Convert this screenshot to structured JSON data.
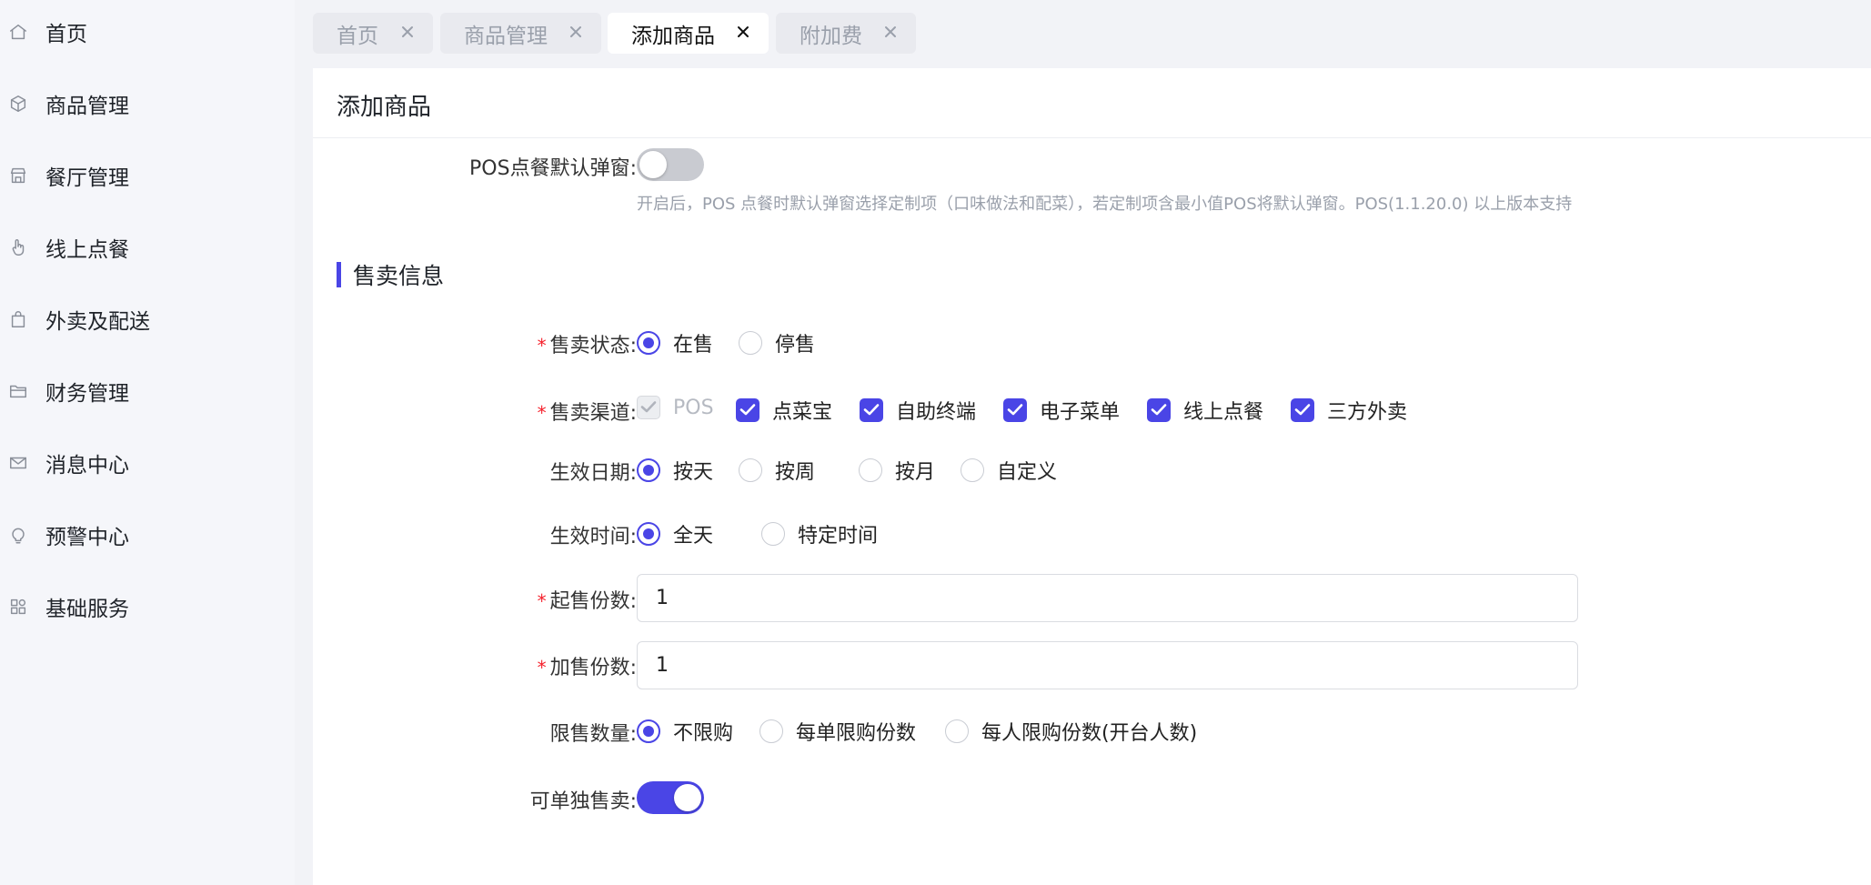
{
  "sidebar": {
    "items": [
      {
        "label": "首页",
        "icon": "home-icon"
      },
      {
        "label": "商品管理",
        "icon": "box-icon"
      },
      {
        "label": "餐厅管理",
        "icon": "store-icon"
      },
      {
        "label": "线上点餐",
        "icon": "hand-pointer-icon"
      },
      {
        "label": "外卖及配送",
        "icon": "shopping-bag-icon"
      },
      {
        "label": "财务管理",
        "icon": "folder-icon"
      },
      {
        "label": "消息中心",
        "icon": "mail-icon"
      },
      {
        "label": "预警中心",
        "icon": "lightbulb-icon"
      },
      {
        "label": "基础服务",
        "icon": "grid-icon"
      }
    ]
  },
  "tabs": [
    {
      "label": "首页",
      "active": false
    },
    {
      "label": "商品管理",
      "active": false
    },
    {
      "label": "添加商品",
      "active": true
    },
    {
      "label": "附加费",
      "active": false
    }
  ],
  "page": {
    "title": "添加商品"
  },
  "pos_popup": {
    "label": "POS点餐默认弹窗:",
    "enabled": false,
    "hint": "开启后，POS 点餐时默认弹窗选择定制项（口味做法和配菜），若定制项含最小值POS将默认弹窗。POS(1.1.20.0) 以上版本支持"
  },
  "section": {
    "title": "售卖信息"
  },
  "form": {
    "sale_status": {
      "label": "售卖状态:",
      "required": "*",
      "options": [
        "在售",
        "停售"
      ],
      "selected": "在售"
    },
    "sale_channel": {
      "label": "售卖渠道:",
      "required": "*",
      "options": [
        "POS",
        "点菜宝",
        "自助终端",
        "电子菜单",
        "线上点餐",
        "三方外卖"
      ],
      "checked": [
        "POS",
        "点菜宝",
        "自助终端",
        "电子菜单",
        "线上点餐",
        "三方外卖"
      ],
      "disabled": [
        "POS"
      ]
    },
    "effective_date": {
      "label": "生效日期:",
      "options": [
        "按天",
        "按周",
        "按月",
        "自定义"
      ],
      "selected": "按天"
    },
    "effective_time": {
      "label": "生效时间:",
      "options": [
        "全天",
        "特定时间"
      ],
      "selected": "全天"
    },
    "min_qty": {
      "label": "起售份数:",
      "required": "*",
      "value": "1"
    },
    "add_qty": {
      "label": "加售份数:",
      "required": "*",
      "value": "1"
    },
    "limit_qty": {
      "label": "限售数量:",
      "options": [
        "不限购",
        "每单限购份数",
        "每人限购份数(开台人数)"
      ],
      "selected": "不限购"
    },
    "sell_alone": {
      "label": "可单独售卖:",
      "enabled": true
    }
  },
  "colors": {
    "accent": "#4a45e6",
    "required": "#f5222d"
  }
}
